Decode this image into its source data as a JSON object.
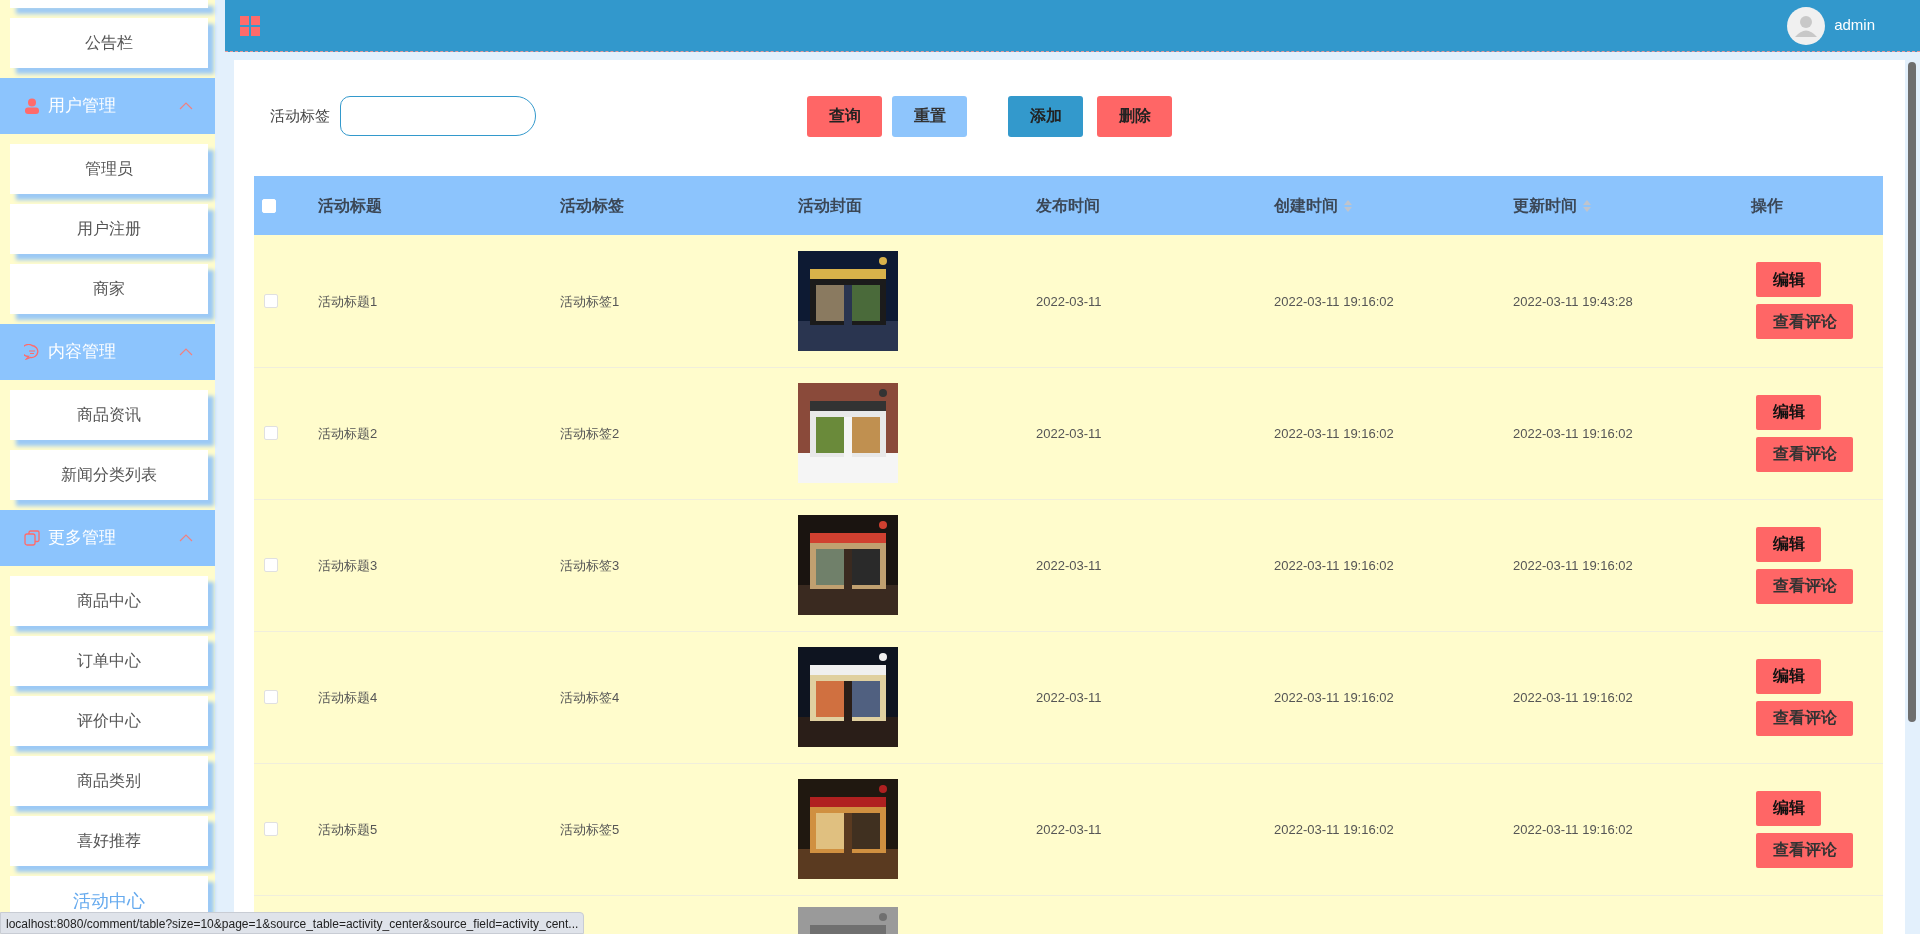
{
  "sidebar": {
    "items": [
      {
        "kind": "item",
        "label": "公告栏",
        "selected": false
      },
      {
        "kind": "group",
        "label": "用户管理",
        "expanded": true
      },
      {
        "kind": "item",
        "label": "管理员",
        "selected": false
      },
      {
        "kind": "item",
        "label": "用户注册",
        "selected": false
      },
      {
        "kind": "item",
        "label": "商家",
        "selected": false
      },
      {
        "kind": "group",
        "label": "内容管理",
        "expanded": true
      },
      {
        "kind": "item",
        "label": "商品资讯",
        "selected": false
      },
      {
        "kind": "item",
        "label": "新闻分类列表",
        "selected": false
      },
      {
        "kind": "group",
        "label": "更多管理",
        "expanded": true
      },
      {
        "kind": "item",
        "label": "商品中心",
        "selected": false
      },
      {
        "kind": "item",
        "label": "订单中心",
        "selected": false
      },
      {
        "kind": "item",
        "label": "评价中心",
        "selected": false
      },
      {
        "kind": "item",
        "label": "商品类别",
        "selected": false
      },
      {
        "kind": "item",
        "label": "喜好推荐",
        "selected": false
      },
      {
        "kind": "item",
        "label": "活动中心",
        "selected": true
      }
    ]
  },
  "topbar": {
    "user": "admin"
  },
  "search": {
    "label": "活动标签"
  },
  "buttons": [
    {
      "label": "查询",
      "kind": "danger"
    },
    {
      "label": "重置",
      "kind": "light"
    },
    {
      "label": "添加",
      "kind": "primary"
    },
    {
      "label": "删除",
      "kind": "danger"
    }
  ],
  "table": {
    "select_all": {
      "checked": false
    },
    "columns": [
      {
        "label": "活动标题",
        "sortable": false
      },
      {
        "label": "活动标签",
        "sortable": false
      },
      {
        "label": "活动封面",
        "sortable": false
      },
      {
        "label": "发布时间",
        "sortable": false
      },
      {
        "label": "创建时间",
        "sortable": true
      },
      {
        "label": "更新时间",
        "sortable": true
      },
      {
        "label": "操作",
        "sortable": false
      }
    ],
    "rows": [
      {
        "checked": false,
        "title": "活动标题1",
        "tag": "活动标签1",
        "cover": {
          "kind": "picture"
        },
        "published": "2022-03-11",
        "created": "2022-03-11 19:16:02",
        "updated": "2022-03-11 19:43:28",
        "actions": [
          "编辑",
          "查看评论"
        ]
      },
      {
        "checked": false,
        "title": "活动标题2",
        "tag": "活动标签2",
        "cover": {
          "kind": "picture"
        },
        "published": "2022-03-11",
        "created": "2022-03-11 19:16:02",
        "updated": "2022-03-11 19:16:02",
        "actions": [
          "编辑",
          "查看评论"
        ]
      },
      {
        "checked": false,
        "title": "活动标题3",
        "tag": "活动标签3",
        "cover": {
          "kind": "picture"
        },
        "published": "2022-03-11",
        "created": "2022-03-11 19:16:02",
        "updated": "2022-03-11 19:16:02",
        "actions": [
          "编辑",
          "查看评论"
        ]
      },
      {
        "checked": false,
        "title": "活动标题4",
        "tag": "活动标签4",
        "cover": {
          "kind": "picture"
        },
        "published": "2022-03-11",
        "created": "2022-03-11 19:16:02",
        "updated": "2022-03-11 19:16:02",
        "actions": [
          "编辑",
          "查看评论"
        ]
      },
      {
        "checked": false,
        "title": "活动标题5",
        "tag": "活动标签5",
        "cover": {
          "kind": "picture"
        },
        "published": "2022-03-11",
        "created": "2022-03-11 19:16:02",
        "updated": "2022-03-11 19:16:02",
        "actions": [
          "编辑",
          "查看评论"
        ]
      },
      {
        "cover": {
          "kind": "picture"
        }
      }
    ]
  },
  "status_bar": "localhost:8080/comment/table?size=10&page=1&source_table=activity_center&source_field=activity_cent..."
}
